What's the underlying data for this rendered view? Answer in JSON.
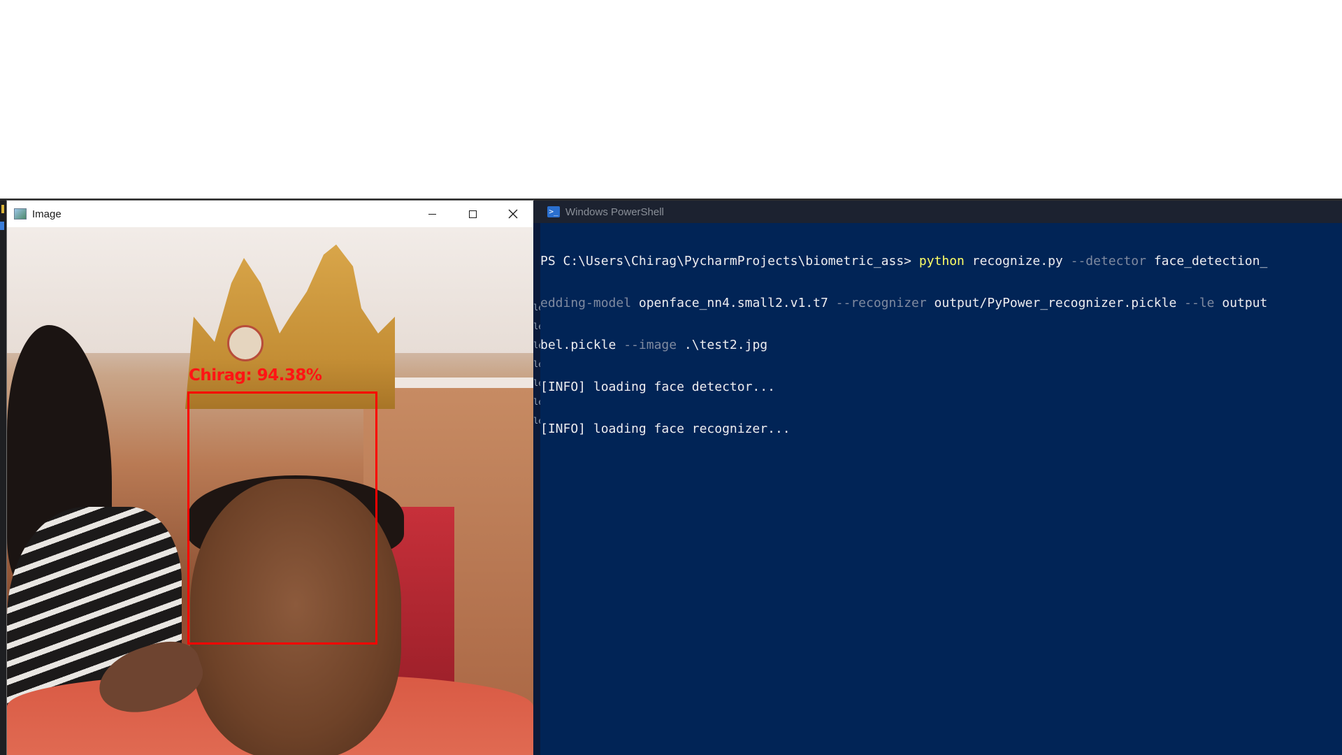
{
  "image_window": {
    "title": "Image",
    "overlay_label": "Chirag: 94.38%",
    "controls": [
      "minimize",
      "maximize",
      "close"
    ]
  },
  "powershell": {
    "title": "Windows PowerShell",
    "lines": [
      {
        "prompt": "PS C:\\Users\\Chirag\\PycharmProjects\\biometric_ass> ",
        "command": "python",
        "arg_script": " recognize.py ",
        "param_detector": "--detector",
        "arg_detector": " face_detection_"
      },
      {
        "param_embedding": "edding-model",
        "arg_embedding": " openface_nn4.small2.v1.t7 ",
        "param_recognizer": "--recognizer",
        "arg_recognizer": " output/PyPower_recognizer.pickle ",
        "param_le": "--le",
        "arg_le": " output"
      },
      {
        "arg_label": "bel.pickle ",
        "param_image": "--image",
        "arg_image": " .\\test2.jpg"
      },
      {
        "text": "[INFO] loading face detector..."
      },
      {
        "text": "[INFO] loading face recognizer..."
      }
    ]
  },
  "colors": {
    "powershell_bg": "#012456",
    "bounding_box": "#ff0000",
    "command_yellow": "#ffff66",
    "parameter_gray": "#7f8aa0"
  },
  "icons": {
    "image_window": "image-app-icon",
    "powershell": "powershell-icon"
  }
}
